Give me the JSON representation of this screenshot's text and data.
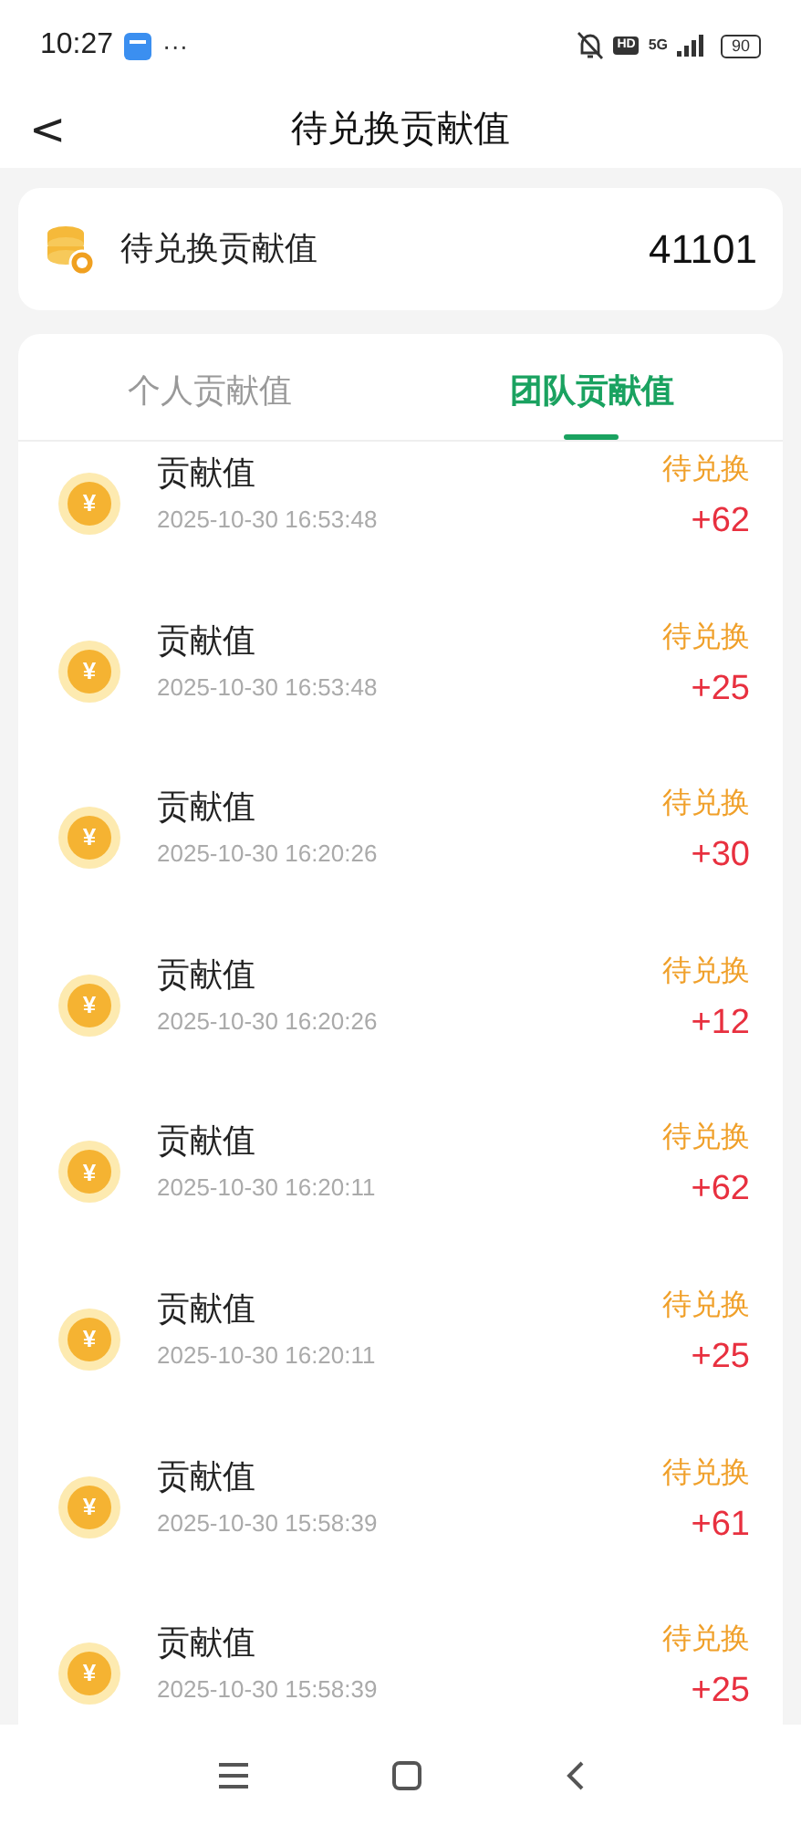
{
  "status_bar": {
    "time": "10:27",
    "more": "···",
    "hd": "HD",
    "network": "5G",
    "battery": "90"
  },
  "header": {
    "back": "<",
    "title": "待兑换贡献值"
  },
  "summary": {
    "label": "待兑换贡献值",
    "value": "41101"
  },
  "tabs": [
    {
      "label": "个人贡献值",
      "selected": false
    },
    {
      "label": "团队贡献值",
      "selected": true
    }
  ],
  "records": [
    {
      "icon": "¥",
      "title": "贡献值",
      "time": "2025-10-30 16:53:48",
      "status": "待兑换",
      "amount": "+62"
    },
    {
      "icon": "¥",
      "title": "贡献值",
      "time": "2025-10-30 16:53:48",
      "status": "待兑换",
      "amount": "+25"
    },
    {
      "icon": "¥",
      "title": "贡献值",
      "time": "2025-10-30 16:20:26",
      "status": "待兑换",
      "amount": "+30"
    },
    {
      "icon": "¥",
      "title": "贡献值",
      "time": "2025-10-30 16:20:26",
      "status": "待兑换",
      "amount": "+12"
    },
    {
      "icon": "¥",
      "title": "贡献值",
      "time": "2025-10-30 16:20:11",
      "status": "待兑换",
      "amount": "+62"
    },
    {
      "icon": "¥",
      "title": "贡献值",
      "time": "2025-10-30 16:20:11",
      "status": "待兑换",
      "amount": "+25"
    },
    {
      "icon": "¥",
      "title": "贡献值",
      "time": "2025-10-30 15:58:39",
      "status": "待兑换",
      "amount": "+61"
    },
    {
      "icon": "¥",
      "title": "贡献值",
      "time": "2025-10-30 15:58:39",
      "status": "待兑换",
      "amount": "+25"
    }
  ]
}
